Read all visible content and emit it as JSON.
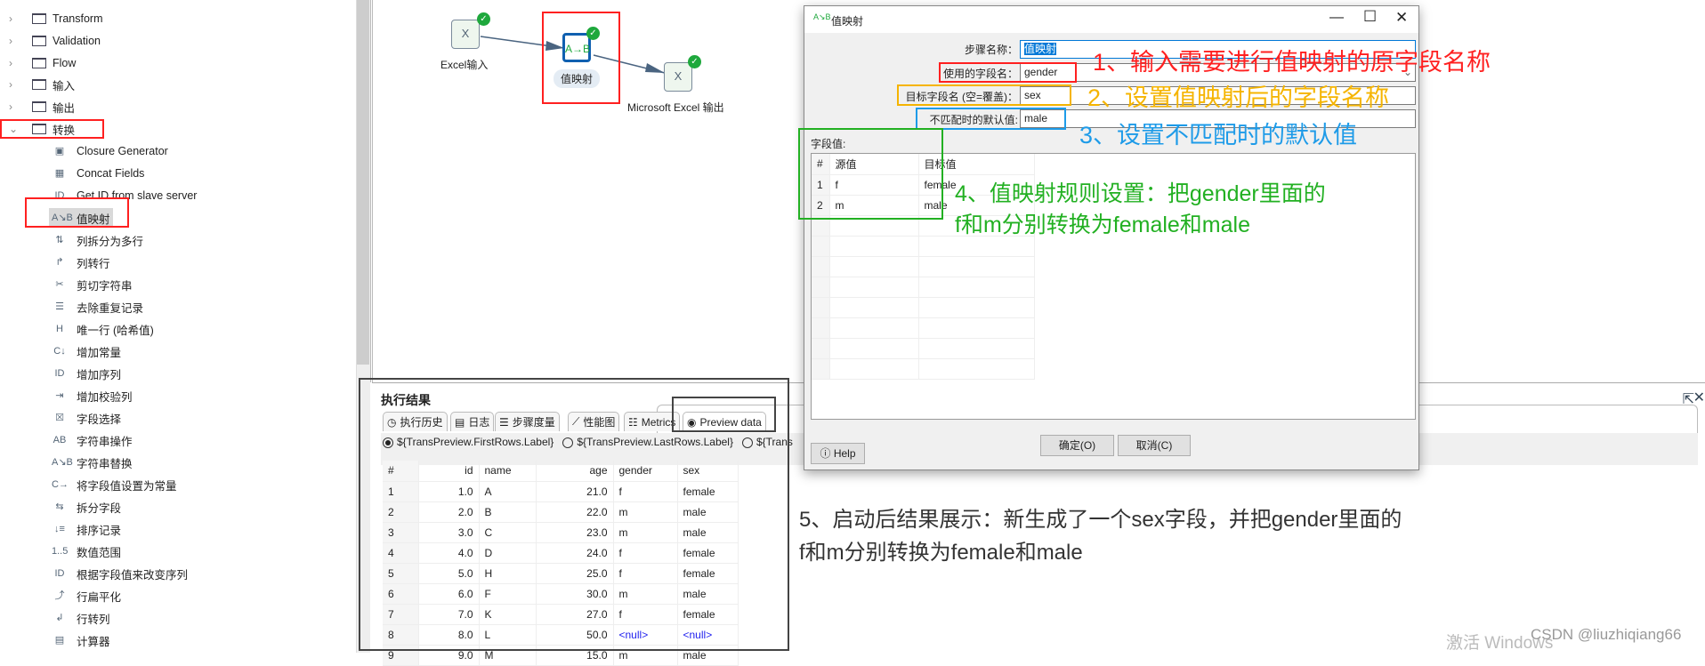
{
  "sidebar": {
    "folders": [
      {
        "label": "Transform",
        "expanded": false
      },
      {
        "label": "Validation",
        "expanded": false
      },
      {
        "label": "Flow",
        "expanded": false
      },
      {
        "label": "输入",
        "expanded": false
      },
      {
        "label": "输出",
        "expanded": false
      },
      {
        "label": "转换",
        "expanded": true
      }
    ],
    "children": [
      {
        "label": "Closure Generator",
        "icon": "cube-gear-icon"
      },
      {
        "label": "Concat Fields",
        "icon": "grid-icon"
      },
      {
        "label": "Get ID from slave server",
        "icon": "id-icon"
      },
      {
        "label": "值映射",
        "icon": "value-mapper-icon",
        "selected": true
      },
      {
        "label": "列拆分为多行",
        "icon": "split-rows-icon"
      },
      {
        "label": "列转行",
        "icon": "column-to-row-icon"
      },
      {
        "label": "剪切字符串",
        "icon": "scissors-icon"
      },
      {
        "label": "去除重复记录",
        "icon": "dedupe-icon"
      },
      {
        "label": "唯一行 (哈希值)",
        "icon": "hash-icon"
      },
      {
        "label": "增加常量",
        "icon": "add-constant-icon"
      },
      {
        "label": "增加序列",
        "icon": "sequence-icon"
      },
      {
        "label": "增加校验列",
        "icon": "checksum-icon"
      },
      {
        "label": "字段选择",
        "icon": "select-fields-icon"
      },
      {
        "label": "字符串操作",
        "icon": "string-ops-icon"
      },
      {
        "label": "字符串替换",
        "icon": "string-replace-icon"
      },
      {
        "label": "将字段值设置为常量",
        "icon": "set-constant-icon"
      },
      {
        "label": "拆分字段",
        "icon": "split-field-icon"
      },
      {
        "label": "排序记录",
        "icon": "sort-icon"
      },
      {
        "label": "数值范围",
        "icon": "number-range-icon"
      },
      {
        "label": "根据字段值来改变序列",
        "icon": "sequence-change-icon"
      },
      {
        "label": "行扁平化",
        "icon": "flatten-icon"
      },
      {
        "label": "行转列",
        "icon": "row-to-column-icon"
      },
      {
        "label": "计算器",
        "icon": "calculator-icon"
      }
    ]
  },
  "canvas": {
    "nodes": [
      {
        "label": "Excel输入",
        "glyph": "X"
      },
      {
        "label": "值映射",
        "glyph": "A→B"
      },
      {
        "label": "Microsoft Excel 输出",
        "glyph": "X"
      }
    ]
  },
  "results": {
    "title": "执行结果",
    "tabs": [
      "执行历史",
      "日志",
      "步骤度量",
      "性能图",
      "Metrics",
      "Preview data"
    ],
    "active_tab": "Preview data",
    "radios": [
      "${TransPreview.FirstRows.Label}",
      "${TransPreview.LastRows.Label}",
      "${Trans"
    ],
    "columns": [
      "#",
      "id",
      "name",
      "age",
      "gender",
      "sex"
    ],
    "rows": [
      [
        "1",
        "1.0",
        "A",
        "21.0",
        "f",
        "female"
      ],
      [
        "2",
        "2.0",
        "B",
        "22.0",
        "m",
        "male"
      ],
      [
        "3",
        "3.0",
        "C",
        "23.0",
        "m",
        "male"
      ],
      [
        "4",
        "4.0",
        "D",
        "24.0",
        "f",
        "female"
      ],
      [
        "5",
        "5.0",
        "H",
        "25.0",
        "f",
        "female"
      ],
      [
        "6",
        "6.0",
        "F",
        "30.0",
        "m",
        "male"
      ],
      [
        "7",
        "7.0",
        "K",
        "27.0",
        "f",
        "female"
      ],
      [
        "8",
        "8.0",
        "L",
        "50.0",
        "<null>",
        "<null>"
      ],
      [
        "9",
        "9.0",
        "M",
        "15.0",
        "m",
        "male"
      ]
    ]
  },
  "dialog": {
    "title": "值映射",
    "step_name_label": "步骤名称：",
    "step_name_value": "值映射",
    "field_label": "使用的字段名：",
    "field_value": "gender",
    "target_label": "目标字段名 (空=覆盖)：",
    "target_value": "sex",
    "default_label": "不匹配时的默认值:",
    "default_value": "male",
    "values_label": "字段值:",
    "map_columns": [
      "#",
      "源值",
      "目标值"
    ],
    "map_rows": [
      [
        "1",
        "f",
        "female"
      ],
      [
        "2",
        "m",
        "male"
      ]
    ],
    "ok": "确定(O)",
    "cancel": "取消(C)",
    "help": "Help"
  },
  "annotations": {
    "a1": "1、输入需要进行值映射的原字段名称",
    "a2": "2、设置值映射后的字段名称",
    "a3": "3、设置不匹配时的默认值",
    "a4_line1": "4、值映射规则设置：把gender里面的",
    "a4_line2": "f和m分别转换为female和male",
    "a5_line1": "5、启动后结果展示：新生成了一个sex字段，并把gender里面的",
    "a5_line2": "f和m分别转换为female和male",
    "colors": {
      "red": "#ff2020",
      "orange": "#f5b400",
      "blue": "#1e9be8",
      "green": "#22b022",
      "dark": "#333333"
    }
  },
  "watermark": {
    "windows": "激活 Windows",
    "csdn": "CSDN @liuzhiqiang66"
  }
}
